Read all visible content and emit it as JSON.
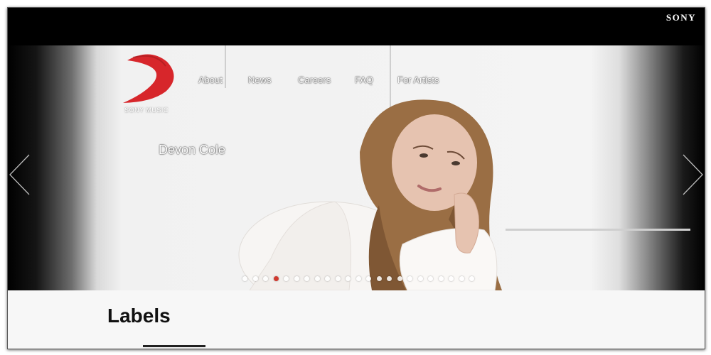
{
  "brand": {
    "corporate": "SONY",
    "logo_text": "SONY MUSIC"
  },
  "nav": {
    "items": [
      {
        "label": "About"
      },
      {
        "label": "News"
      },
      {
        "label": "Careers"
      },
      {
        "label": "FAQ"
      },
      {
        "label": "For Artists"
      }
    ]
  },
  "hero": {
    "artist": "Devon Cole",
    "slide_count": 23,
    "active_slide": 4,
    "prev_icon": "chevron-left-icon",
    "next_icon": "chevron-right-icon"
  },
  "labels_section": {
    "heading": "Labels"
  },
  "colors": {
    "accent": "#d03a2f",
    "topbar": "#000000",
    "section_bg": "#f7f7f7"
  }
}
